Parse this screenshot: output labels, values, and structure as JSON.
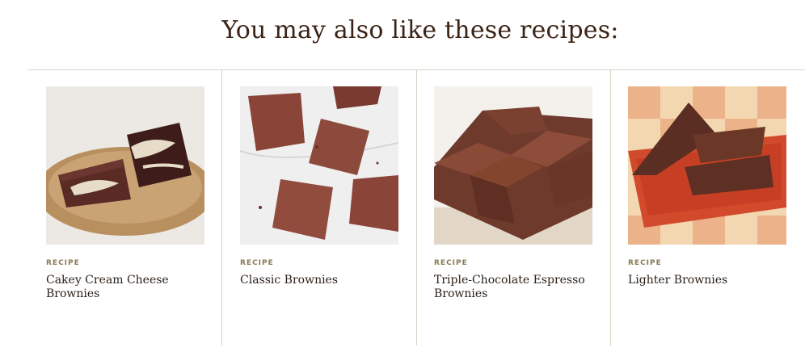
{
  "section": {
    "heading": "You may also like these recipes:"
  },
  "cards": [
    {
      "label": "RECIPE",
      "title": "Cakey Cream Cheese Brownies"
    },
    {
      "label": "RECIPE",
      "title": "Classic Brownies"
    },
    {
      "label": "RECIPE",
      "title": "Triple-Chocolate Espresso Brownies"
    },
    {
      "label": "RECIPE",
      "title": "Lighter Brownies"
    }
  ],
  "colors": {
    "text": "#2b2018",
    "label": "#8a7a55",
    "rule": "#d8d2c7"
  }
}
